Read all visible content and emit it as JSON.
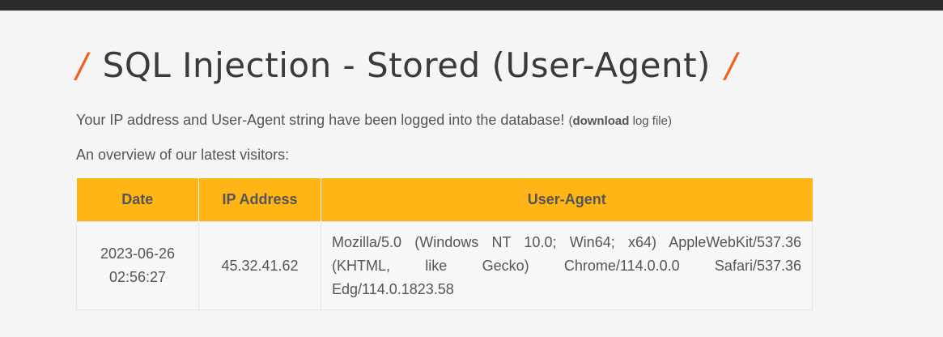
{
  "page": {
    "title": "SQL Injection - Stored (User-Agent)",
    "title_slash": "/",
    "intro_text": "Your IP address and User-Agent string have been logged into the database!",
    "download_paren_open": "(",
    "download_link": "download",
    "download_rest": " log file)",
    "overview_text": "An overview of our latest visitors:"
  },
  "table": {
    "headers": [
      "Date",
      "IP Address",
      "User-Agent"
    ],
    "rows": [
      {
        "date": "2023-06-26",
        "time": "02:56:27",
        "ip": "45.32.41.62",
        "user_agent": "Mozilla/5.0 (Windows NT 10.0; Win64; x64) AppleWebKit/537.36 (KHTML, like Gecko) Chrome/114.0.0.0 Safari/537.36 Edg/114.0.1823.58"
      }
    ]
  },
  "colors": {
    "accent_orange": "#ee6322",
    "header_yellow": "#ffb515",
    "top_bar": "#2b2b2b",
    "background": "#f5f5f5"
  }
}
